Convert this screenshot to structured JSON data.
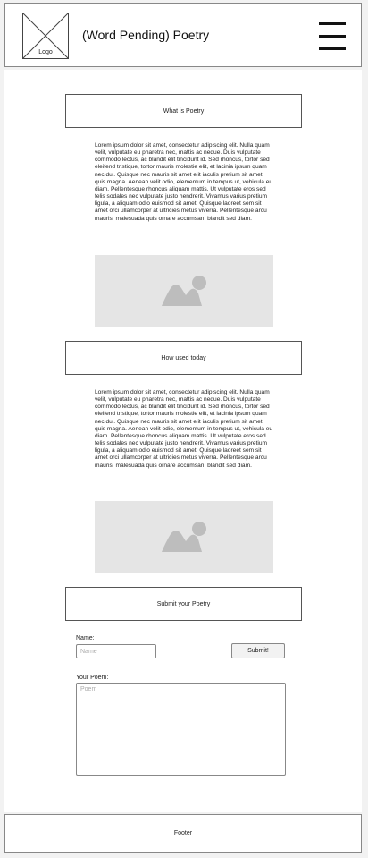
{
  "header": {
    "logo_label": "Logo",
    "title": "(Word Pending) Poetry",
    "menu_icon": "hamburger-menu-icon"
  },
  "sections": [
    {
      "heading": "What is Poetry",
      "body": "Lorem ipsum dolor sit amet, consectetur adipiscing elit. Nulla quam velit, vulputate eu pharetra nec, mattis ac neque. Duis vulputate commodo lectus, ac blandit elit tincidunt id. Sed rhoncus, tortor sed eleifend tristique, tortor mauris molestie elit, et lacinia ipsum quam nec dui. Quisque nec mauris sit amet elit iaculis pretium sit amet quis magna. Aenean velit odio, elementum in tempus ut, vehicula eu diam. Pellentesque rhoncus aliquam mattis. Ut vulputate eros sed felis sodales nec vulputate justo hendrerit. Vivamus varius pretium ligula, a aliquam odio euismod sit amet. Quisque laoreet sem sit amet orci ullamcorper at ultricies metus viverra. Pellentesque arcu mauris, malesuada quis ornare accumsan, blandit sed diam.",
      "image_icon": "image-placeholder-icon"
    },
    {
      "heading": "How used today",
      "body": "Lorem ipsum dolor sit amet, consectetur adipiscing elit. Nulla quam velit, vulputate eu pharetra nec, mattis ac neque. Duis vulputate commodo lectus, ac blandit elit tincidunt id. Sed rhoncus, tortor sed eleifend tristique, tortor mauris molestie elit, et lacinia ipsum quam nec dui. Quisque nec mauris sit amet elit iaculis pretium sit amet quis magna. Aenean velit odio, elementum in tempus ut, vehicula eu diam. Pellentesque rhoncus aliquam mattis. Ut vulputate eros sed felis sodales nec vulputate justo hendrerit. Vivamus varius pretium ligula, a aliquam odio euismod sit amet. Quisque laoreet sem sit amet orci ullamcorper at ultricies metus viverra. Pellentesque arcu mauris, malesuada quis ornare accumsan, blandit sed diam.",
      "image_icon": "image-placeholder-icon"
    }
  ],
  "submit": {
    "heading": "Submit your Poetry",
    "name_label": "Name:",
    "name_placeholder": "Name",
    "name_value": "",
    "submit_label": "Submit!",
    "poem_label": "Your Poem:",
    "poem_placeholder": "Poem",
    "poem_value": ""
  },
  "footer": {
    "label": "Footer"
  },
  "colors": {
    "page_bg": "#f2f2f2",
    "panel_bg": "#ffffff",
    "placeholder_bg": "#e5e5e5",
    "placeholder_icon": "#bdbdbd",
    "border": "#888888"
  }
}
